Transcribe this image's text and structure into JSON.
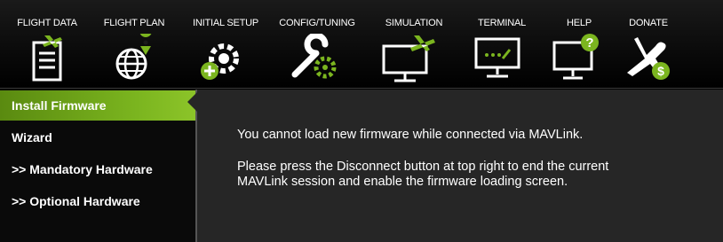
{
  "toolbar": {
    "items": [
      {
        "label": "FLIGHT DATA",
        "icon": "flight-data-icon"
      },
      {
        "label": "FLIGHT PLAN",
        "icon": "flight-plan-icon"
      },
      {
        "label": "INITIAL SETUP",
        "icon": "initial-setup-icon"
      },
      {
        "label": "CONFIG/TUNING",
        "icon": "config-tuning-icon"
      },
      {
        "label": "SIMULATION",
        "icon": "simulation-icon"
      },
      {
        "label": "TERMINAL",
        "icon": "terminal-icon"
      },
      {
        "label": "HELP",
        "icon": "help-icon"
      },
      {
        "label": "DONATE",
        "icon": "donate-icon"
      }
    ]
  },
  "sidebar": {
    "items": [
      {
        "label": "Install Firmware",
        "active": true
      },
      {
        "label": "Wizard"
      },
      {
        "label": ">> Mandatory Hardware"
      },
      {
        "label": ">> Optional Hardware"
      }
    ]
  },
  "content": {
    "line1": "You cannot load new firmware while connected via MAVLink.",
    "line2": "Please press the Disconnect button at top right to end the current",
    "line3": "MAVLink session and enable the firmware loading screen."
  },
  "colors": {
    "accent_green": "#8cc429",
    "icon_green": "#7bb51f",
    "icon_white": "#ffffff",
    "panel": "#262626"
  }
}
